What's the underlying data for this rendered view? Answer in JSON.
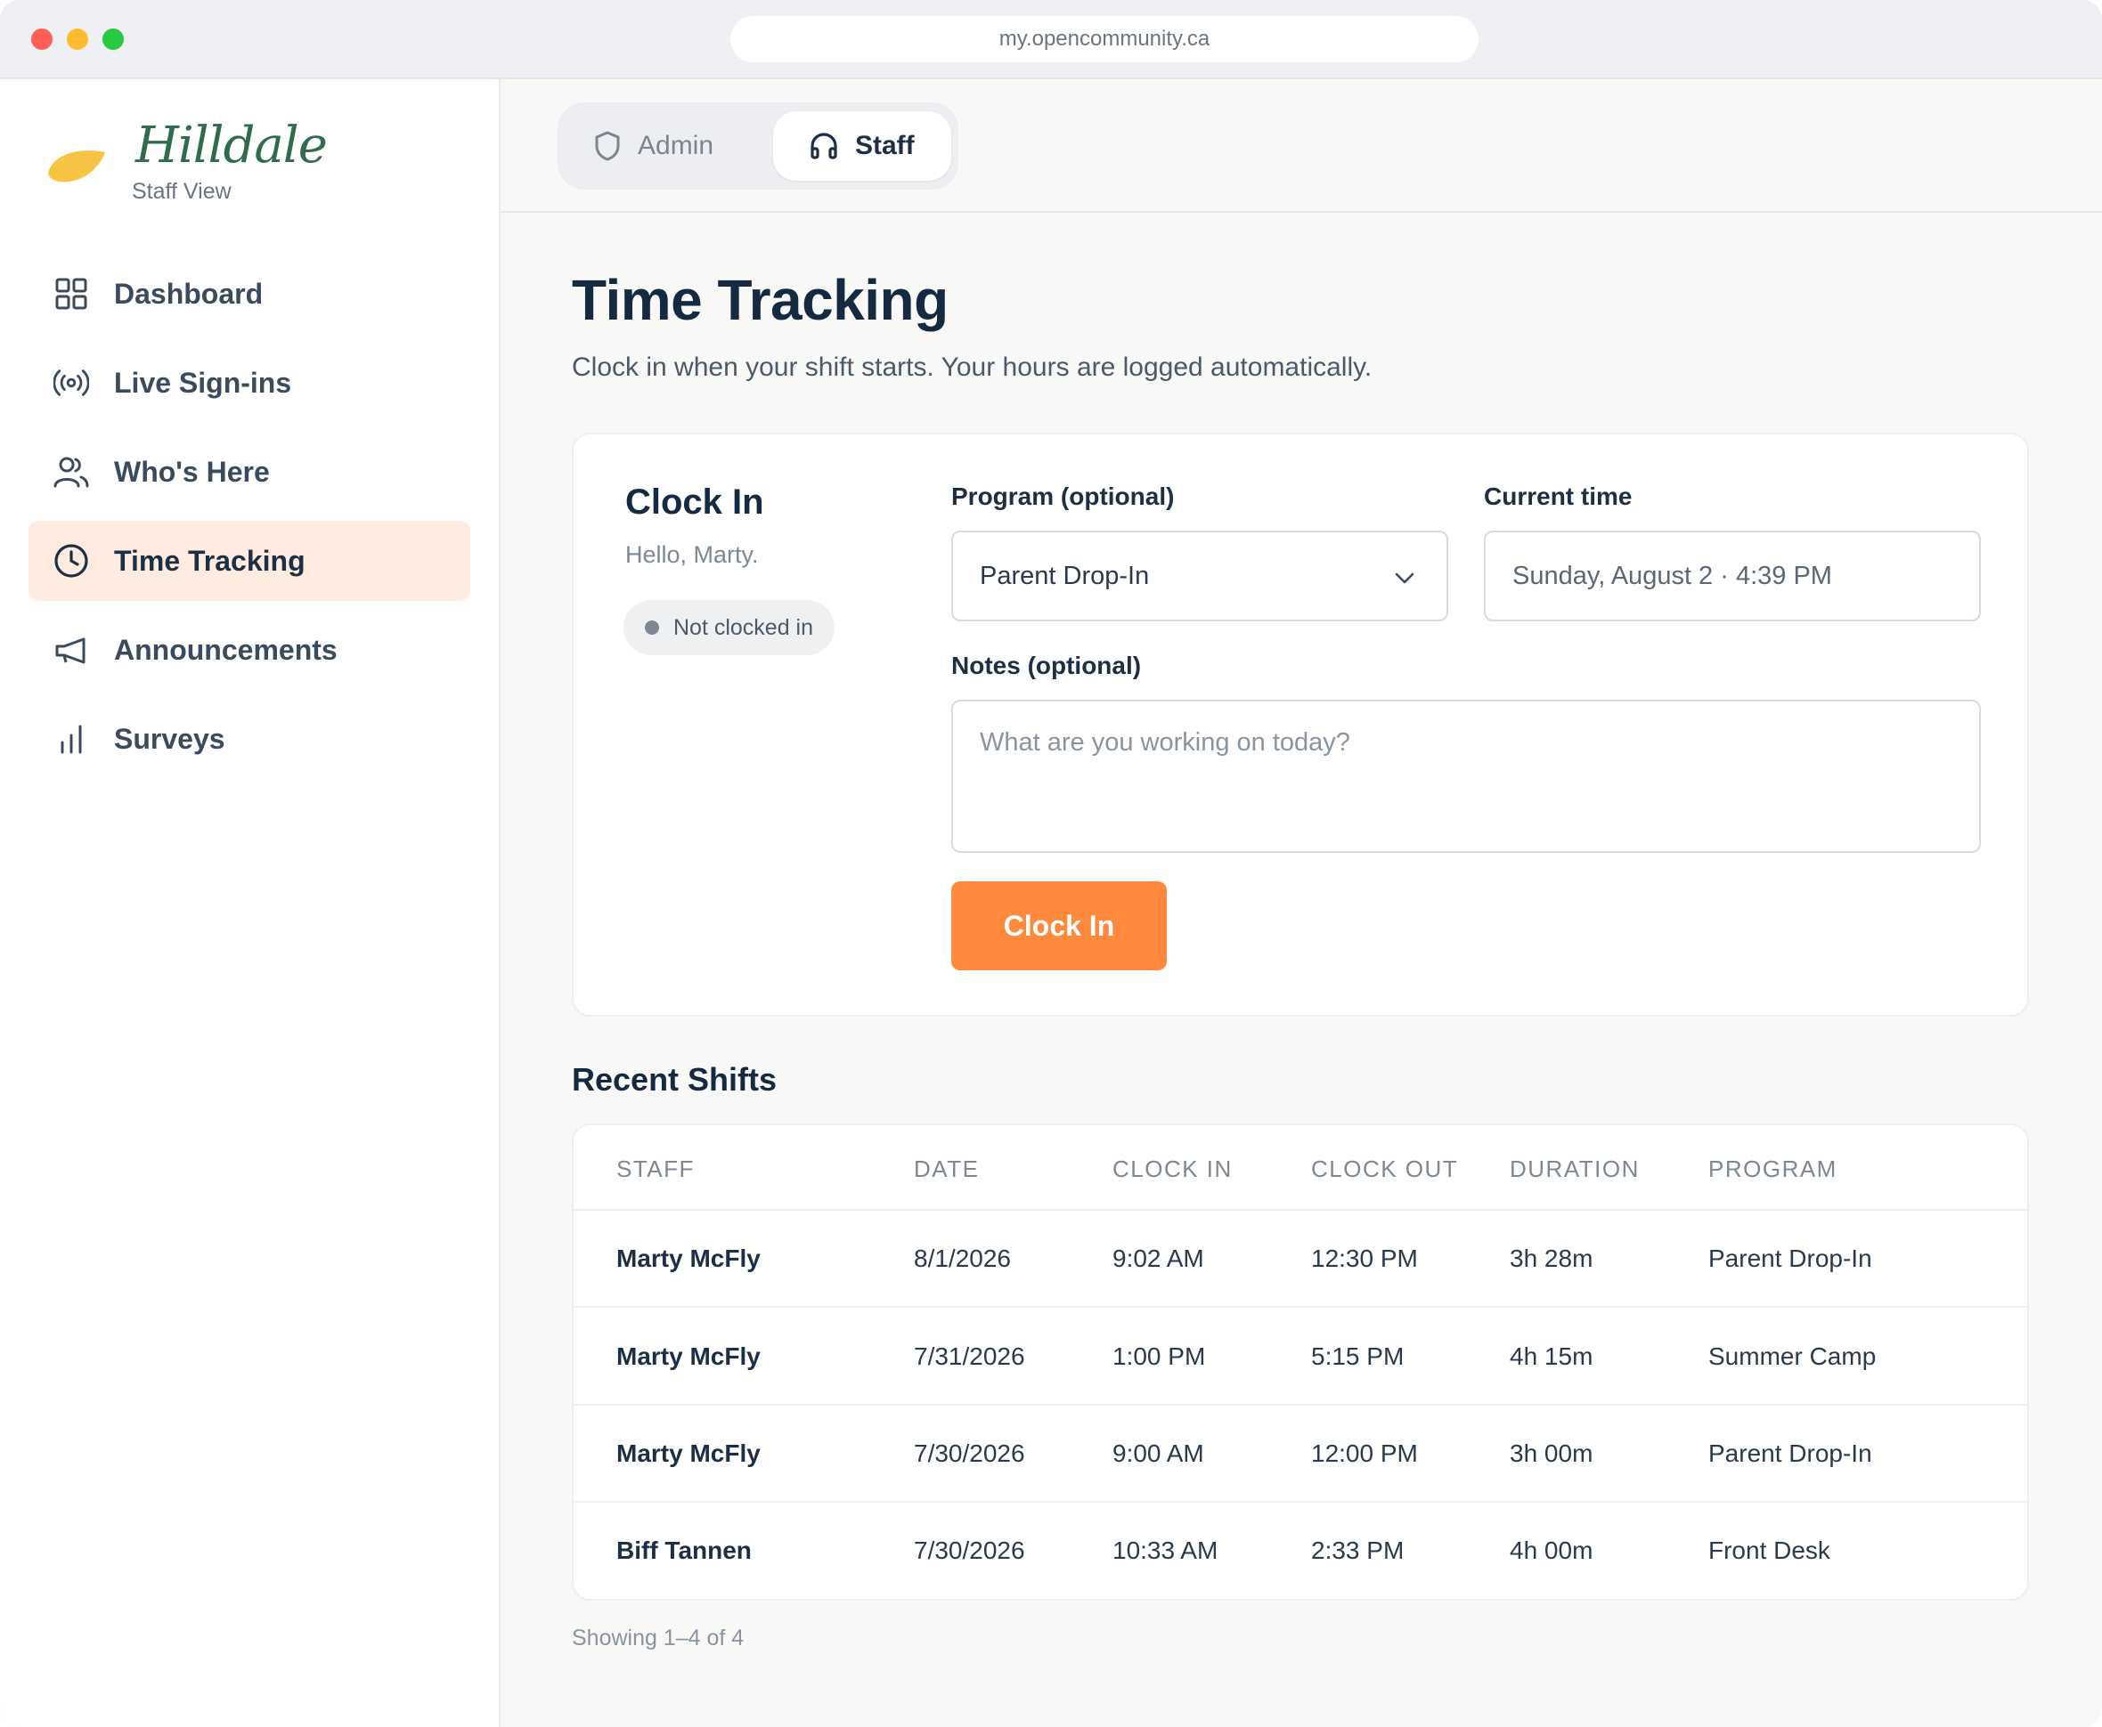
{
  "browser": {
    "url": "my.opencommunity.ca"
  },
  "brand": {
    "name": "Hilldale",
    "subtitle": "Staff View"
  },
  "sidebar": {
    "items": [
      {
        "label": "Dashboard",
        "icon": "grid-icon",
        "active": false
      },
      {
        "label": "Live Sign-ins",
        "icon": "broadcast-icon",
        "active": false
      },
      {
        "label": "Who's Here",
        "icon": "users-icon",
        "active": false
      },
      {
        "label": "Time Tracking",
        "icon": "clock-icon",
        "active": true
      },
      {
        "label": "Announcements",
        "icon": "megaphone-icon",
        "active": false
      },
      {
        "label": "Surveys",
        "icon": "bar-chart-icon",
        "active": false
      }
    ]
  },
  "role_switch": {
    "admin_label": "Admin",
    "staff_label": "Staff",
    "selected": "Staff"
  },
  "page": {
    "title": "Time Tracking",
    "subtitle": "Clock in when your shift starts. Your hours are logged automatically."
  },
  "clock_card": {
    "title": "Clock In",
    "greeting": "Hello, Marty.",
    "status": "Not clocked in",
    "program_label": "Program (optional)",
    "program_value": "Parent Drop-In",
    "time_label": "Current time",
    "time_value": "Sunday, August 2 · 4:39 PM",
    "notes_label": "Notes (optional)",
    "notes_placeholder": "What are you working on today?",
    "button_label": "Clock In"
  },
  "shifts": {
    "title": "Recent Shifts",
    "columns": [
      "STAFF",
      "DATE",
      "CLOCK IN",
      "CLOCK OUT",
      "DURATION",
      "PROGRAM"
    ],
    "rows": [
      [
        "Marty McFly",
        "8/1/2026",
        "9:02 AM",
        "12:30 PM",
        "3h 28m",
        "Parent Drop-In"
      ],
      [
        "Marty McFly",
        "7/31/2026",
        "1:00 PM",
        "5:15 PM",
        "4h 15m",
        "Summer Camp"
      ],
      [
        "Marty McFly",
        "7/30/2026",
        "9:00 AM",
        "12:00 PM",
        "3h 00m",
        "Parent Drop-In"
      ],
      [
        "Biff Tannen",
        "7/30/2026",
        "10:33 AM",
        "2:33 PM",
        "4h 00m",
        "Front Desk"
      ]
    ],
    "footer": "Showing 1–4 of 4"
  },
  "colors": {
    "accent": "#ff8a3d",
    "brand_green": "#2f6b4c",
    "active_nav_bg": "#fdecdf"
  }
}
